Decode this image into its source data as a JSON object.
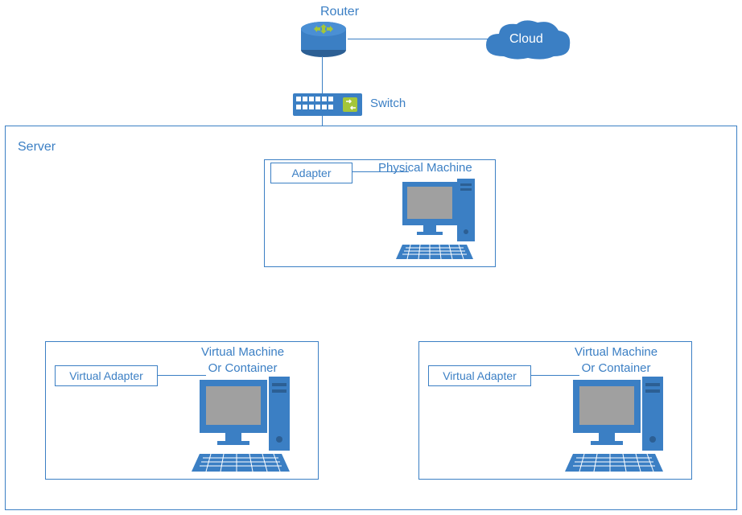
{
  "labels": {
    "router": "Router",
    "cloud": "Cloud",
    "switch": "Switch",
    "server": "Server",
    "adapter": "Adapter",
    "physical_machine": "Physical Machine",
    "virtual_adapter_1": "Virtual Adapter",
    "virtual_machine_1_line1": "Virtual Machine",
    "virtual_machine_1_line2": "Or Container",
    "virtual_adapter_2": "Virtual Adapter",
    "virtual_machine_2_line1": "Virtual Machine",
    "virtual_machine_2_line2": "Or Container"
  },
  "colors": {
    "primary": "#3b7fc4",
    "accent": "#a4c639",
    "gray": "#a0a0a0",
    "darkblue": "#2c5f94"
  }
}
